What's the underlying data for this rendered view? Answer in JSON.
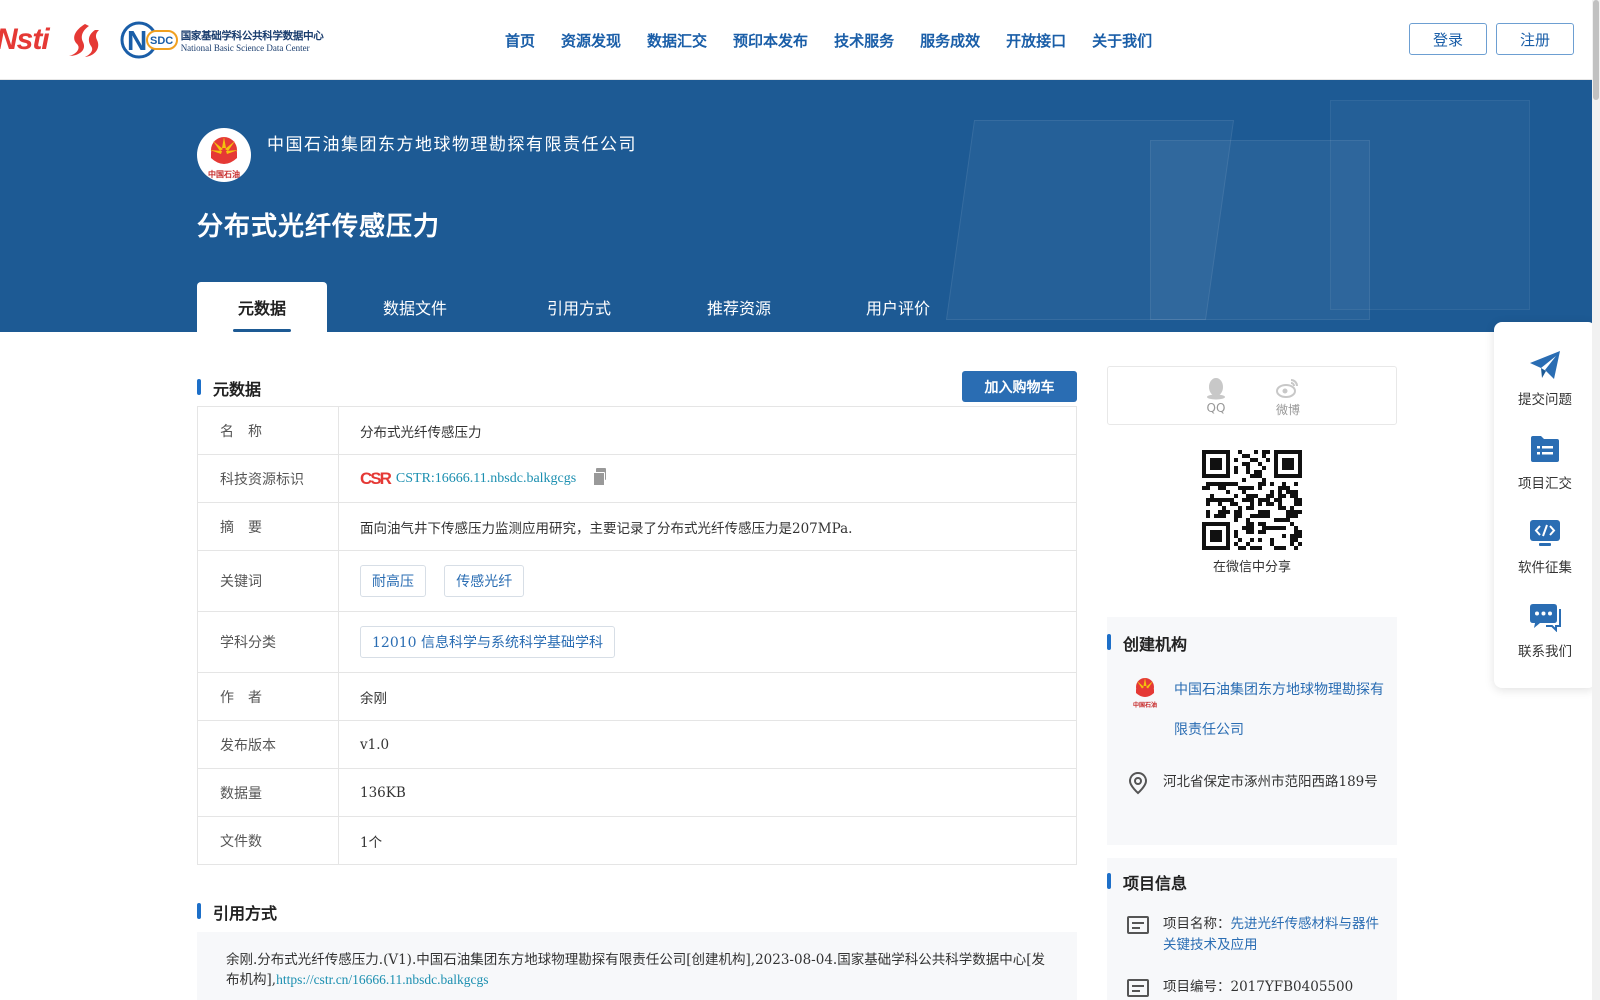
{
  "header": {
    "logo_nsti": "Nsti",
    "logo_nsdc_cn": "国家基础学科公共科学数据中心",
    "logo_nsdc_en": "National Basic Science Data Center",
    "logo_nsdc_mark": "SDC",
    "nav": [
      "首页",
      "资源发现",
      "数据汇交",
      "预印本发布",
      "技术服务",
      "服务成效",
      "开放接口",
      "关于我们"
    ],
    "login": "登录",
    "register": "注册"
  },
  "hero": {
    "org_name": "中国石油集团东方地球物理勘探有限责任公司",
    "title": "分布式光纤传感压力",
    "logo_caption": "中国石油",
    "tabs": [
      "元数据",
      "数据文件",
      "引用方式",
      "推荐资源",
      "用户评价"
    ],
    "active_tab": "元数据"
  },
  "metadata": {
    "section_title": "元数据",
    "cart_button": "加入购物车",
    "rows": {
      "name": {
        "label": "名　称",
        "value": "分布式光纤传感压力"
      },
      "cstr": {
        "label": "科技资源标识",
        "badge": "CSR",
        "value": "CSTR:16666.11.nbsdc.balkgcgs"
      },
      "abstract": {
        "label": "摘　要",
        "value": "面向油气井下传感压力监测应用研究，主要记录了分布式光纤传感压力是207MPa."
      },
      "keywords": {
        "label": "关键词",
        "values": [
          "耐高压",
          "传感光纤"
        ]
      },
      "subject": {
        "label": "学科分类",
        "value": "12010 信息科学与系统科学基础学科"
      },
      "author": {
        "label": "作　者",
        "value": "余刚"
      },
      "version": {
        "label": "发布版本",
        "value": "v1.0"
      },
      "size": {
        "label": "数据量",
        "value": "136KB"
      },
      "files": {
        "label": "文件数",
        "value": "1个"
      }
    }
  },
  "citation": {
    "section_title": "引用方式",
    "text": "余刚.分布式光纤传感压力.(V1).中国石油集团东方地球物理勘探有限责任公司[创建机构],2023-08-04.国家基础学科公共科学数据中心[发布机构],",
    "link": "https://cstr.cn/16666.11.nbsdc.balkgcgs"
  },
  "share": {
    "qq": "QQ",
    "weibo": "微博",
    "wechat_label": "在微信中分享"
  },
  "creator": {
    "section_title": "创建机构",
    "name": "中国石油集团东方地球物理勘探有限责任公司",
    "address": "河北省保定市涿州市范阳西路189号"
  },
  "project": {
    "section_title": "项目信息",
    "name_label": "项目名称：",
    "name_value": "先进光纤传感材料与器件关键技术及应用",
    "code_label": "项目编号：",
    "code_value": "2017YFB0405500"
  },
  "float_bar": {
    "items": [
      "提交问题",
      "项目汇交",
      "软件征集",
      "联系我们"
    ]
  },
  "colors": {
    "brand_blue": "#1d5a94",
    "link_blue": "#2a6db3",
    "cstr_teal": "#1b8fb0",
    "accent_red": "#e53935"
  }
}
